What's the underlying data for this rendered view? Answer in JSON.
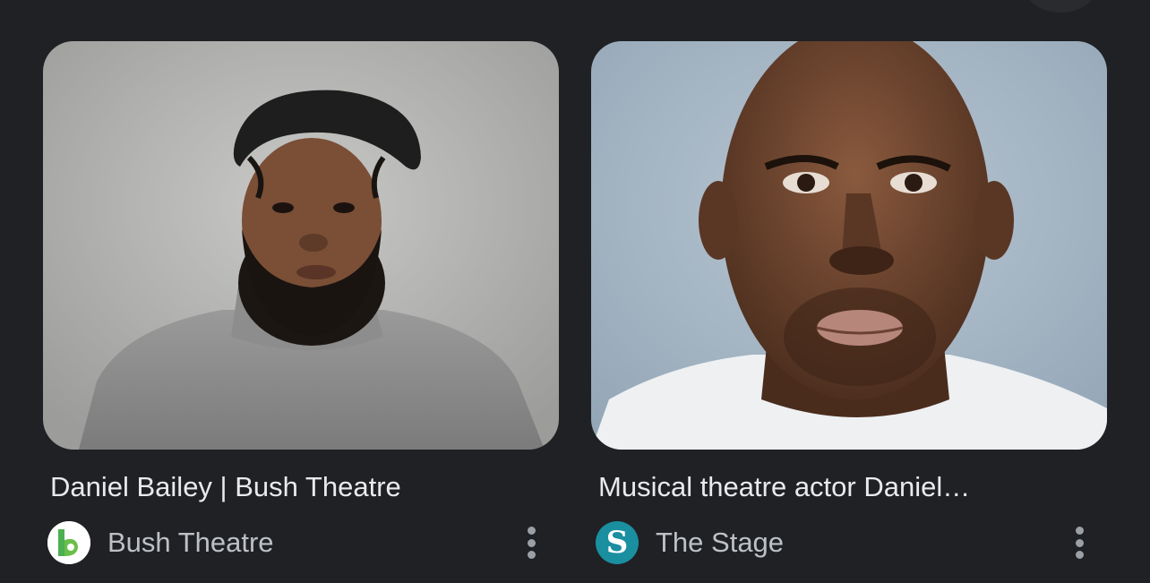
{
  "results": [
    {
      "title": "Daniel Bailey | Bush Theatre",
      "source": "Bush Theatre",
      "favicon_icon": "bush-theatre-logo-icon",
      "favicon_bg": "#ffffff",
      "favicon_accent": "#4caf50"
    },
    {
      "title": "Musical theatre actor Daniel…",
      "source": "The Stage",
      "favicon_icon": "the-stage-logo-icon",
      "favicon_bg": "#1a8fa0",
      "favicon_letter": "S"
    }
  ],
  "more_icon": "more-vert-icon"
}
